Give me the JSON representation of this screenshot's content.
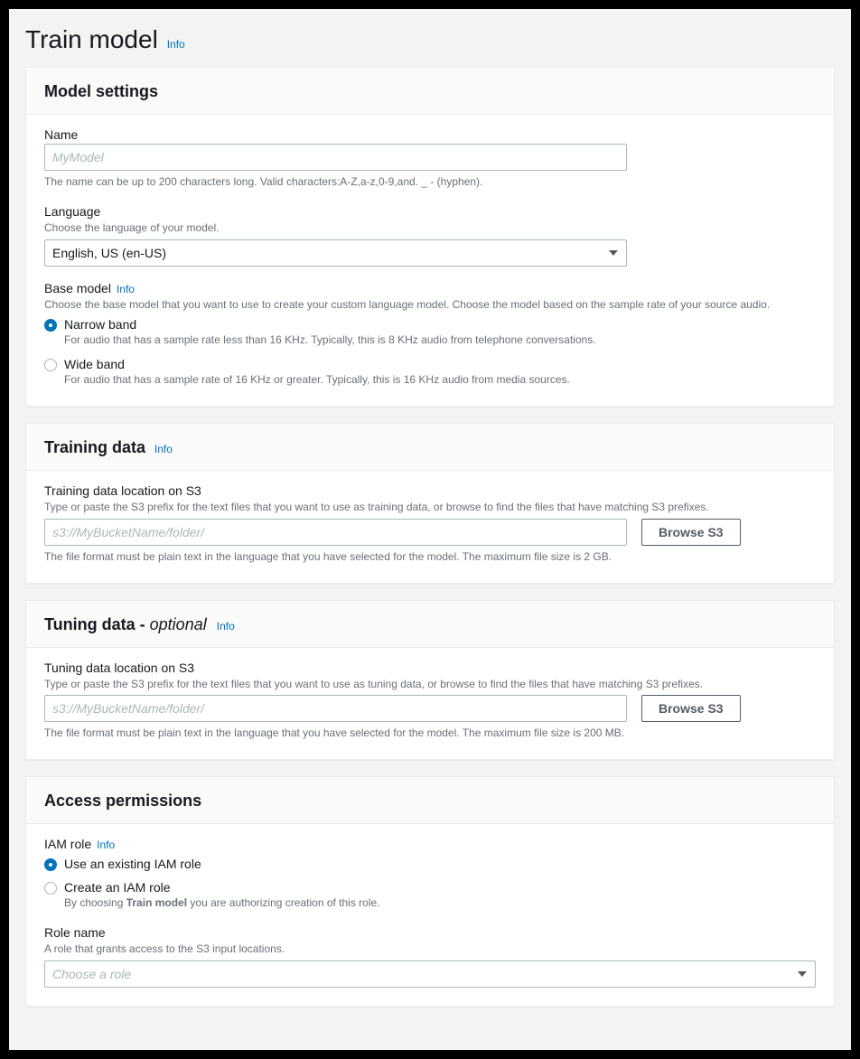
{
  "header": {
    "title": "Train model",
    "info": "Info"
  },
  "modelSettings": {
    "title": "Model settings",
    "name": {
      "label": "Name",
      "placeholder": "MyModel",
      "hint": "The name can be up to 200 characters long. Valid characters:A-Z,a-z,0-9,and. _ - (hyphen)."
    },
    "language": {
      "label": "Language",
      "description": "Choose the language of your model.",
      "value": "English, US (en-US)"
    },
    "baseModel": {
      "label": "Base model",
      "info": "Info",
      "description": "Choose the base model that you want to use to create your custom language model. Choose the model based on the sample rate of your source audio.",
      "options": [
        {
          "label": "Narrow band",
          "desc": "For audio that has a sample rate less than 16 KHz. Typically, this is 8 KHz audio from telephone conversations.",
          "checked": true
        },
        {
          "label": "Wide band",
          "desc": "For audio that has a sample rate of 16 KHz or greater. Typically, this is 16 KHz audio from media sources.",
          "checked": false
        }
      ]
    }
  },
  "trainingData": {
    "title": "Training data",
    "info": "Info",
    "location": {
      "label": "Training data location on S3",
      "description": "Type or paste the S3 prefix for the text files that you want to use as training data, or browse to find the files that have matching S3 prefixes.",
      "placeholder": "s3://MyBucketName/folder/",
      "browse": "Browse S3",
      "hint": "The file format must be plain text in the language that you have selected for the model. The maximum file size is 2 GB."
    }
  },
  "tuningData": {
    "title": "Tuning data - ",
    "optional": "optional",
    "info": "Info",
    "location": {
      "label": "Tuning data location on S3",
      "description": "Type or paste the S3 prefix for the text files that you want to use as tuning data, or browse to find the files that have matching S3 prefixes.",
      "placeholder": "s3://MyBucketName/folder/",
      "browse": "Browse S3",
      "hint": "The file format must be plain text in the language that you have selected for the model. The maximum file size is 200 MB."
    }
  },
  "accessPermissions": {
    "title": "Access permissions",
    "iamRole": {
      "label": "IAM role",
      "info": "Info",
      "options": [
        {
          "label": "Use an existing IAM role",
          "desc": "",
          "checked": true
        },
        {
          "label": "Create an IAM role",
          "descPrefix": "By choosing ",
          "descBold": "Train model",
          "descSuffix": " you are authorizing creation of this role.",
          "checked": false
        }
      ]
    },
    "roleName": {
      "label": "Role name",
      "description": "A role that grants access to the S3 input locations.",
      "placeholder": "Choose a role"
    }
  }
}
